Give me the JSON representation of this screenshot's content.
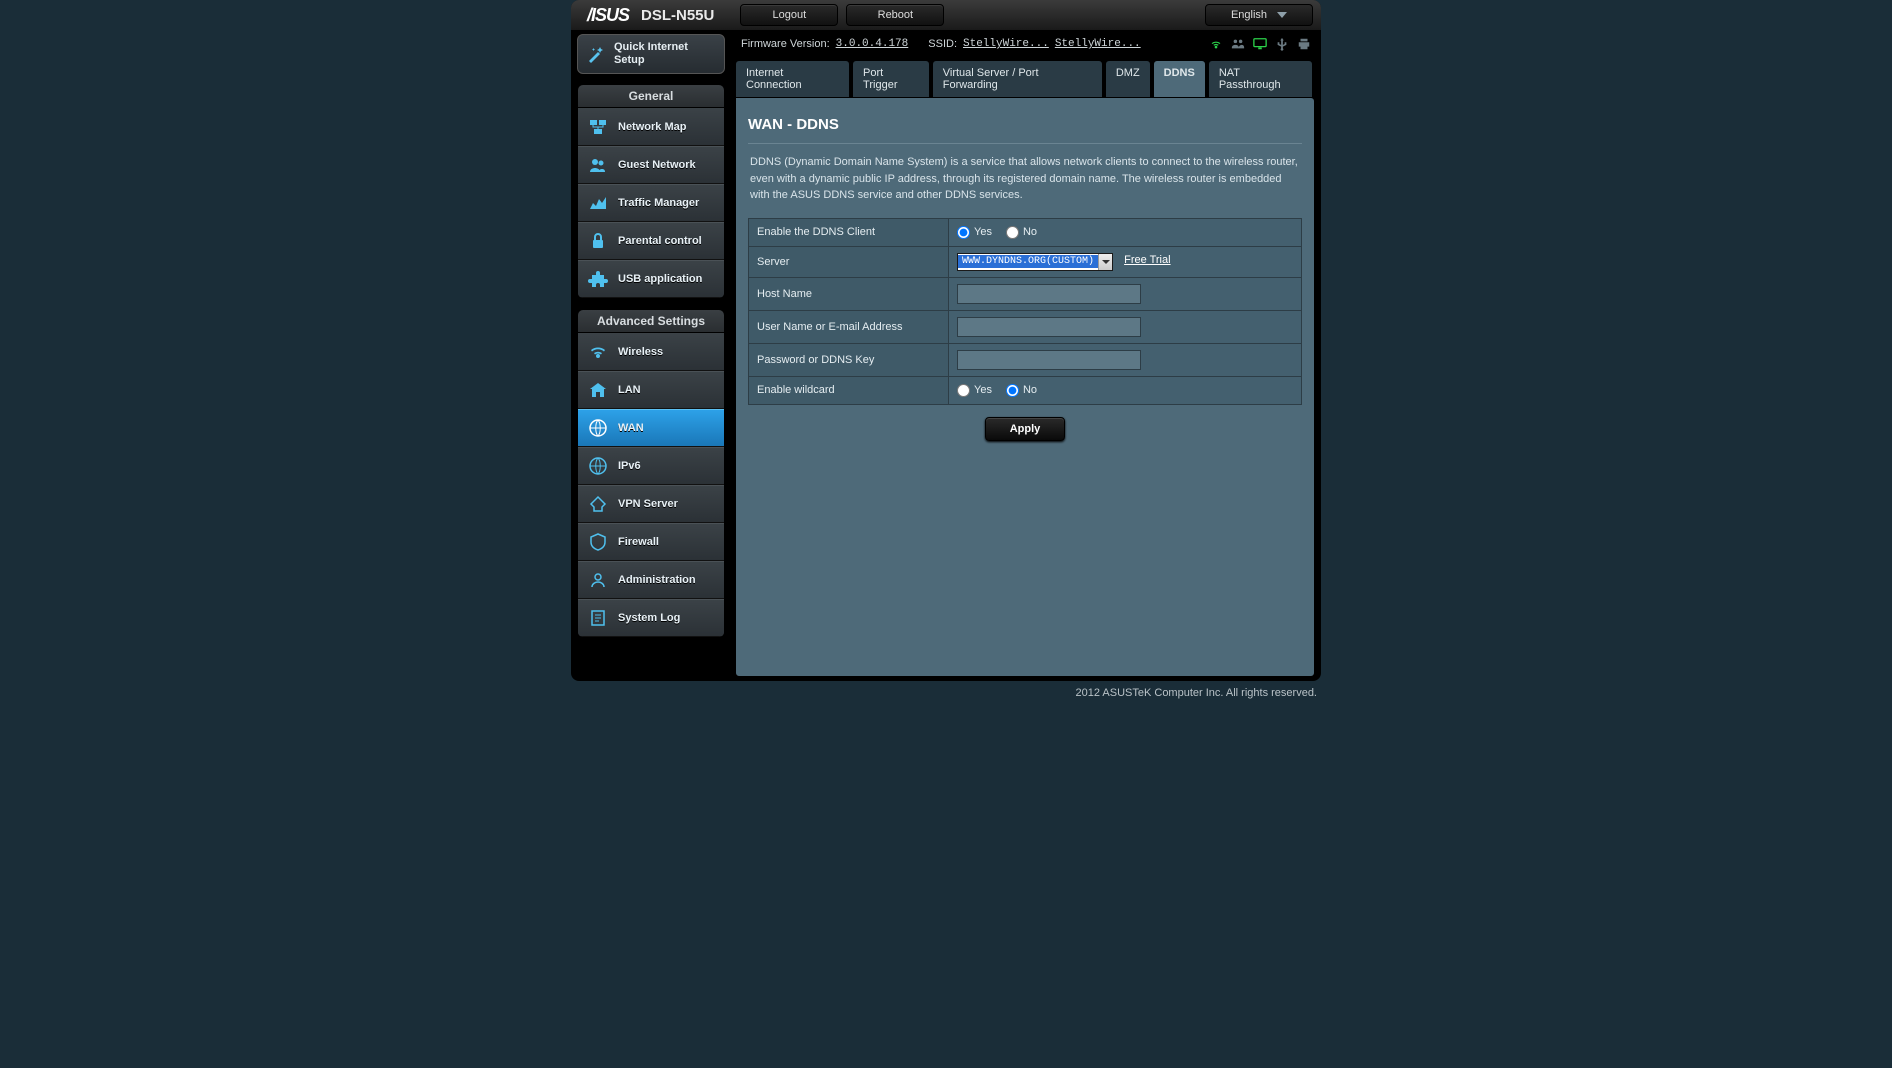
{
  "topbar": {
    "brand": "/ISUS",
    "model": "DSL-N55U",
    "logout": "Logout",
    "reboot": "Reboot",
    "language": "English"
  },
  "info": {
    "fw_label": "Firmware Version:",
    "fw_value": "3.0.0.4.178",
    "ssid_label": "SSID:",
    "ssid1": "StellyWire...",
    "ssid2": "StellyWire..."
  },
  "quick_setup": "Quick Internet Setup",
  "nav_general_title": "General",
  "nav_general": [
    {
      "label": "Network Map"
    },
    {
      "label": "Guest Network"
    },
    {
      "label": "Traffic Manager"
    },
    {
      "label": "Parental control"
    },
    {
      "label": "USB application"
    }
  ],
  "nav_advanced_title": "Advanced Settings",
  "nav_advanced": [
    {
      "label": "Wireless"
    },
    {
      "label": "LAN"
    },
    {
      "label": "WAN"
    },
    {
      "label": "IPv6"
    },
    {
      "label": "VPN Server"
    },
    {
      "label": "Firewall"
    },
    {
      "label": "Administration"
    },
    {
      "label": "System Log"
    }
  ],
  "tabs": [
    "Internet Connection",
    "Port Trigger",
    "Virtual Server / Port Forwarding",
    "DMZ",
    "DDNS",
    "NAT Passthrough"
  ],
  "panel": {
    "title": "WAN - DDNS",
    "description": "DDNS (Dynamic Domain Name System) is a service that allows network clients to connect to the wireless router, even with a dynamic public IP address, through its registered domain name. The wireless router is embedded with the ASUS DDNS service and other DDNS services.",
    "rows": {
      "enable_client": "Enable the DDNS Client",
      "server": "Server",
      "server_value": "WWW.DYNDNS.ORG(CUSTOM)",
      "free_trial": "Free Trial",
      "host_name": "Host Name",
      "user_email": "User Name or E-mail Address",
      "password": "Password or DDNS Key",
      "enable_wildcard": "Enable wildcard"
    },
    "yes": "Yes",
    "no": "No",
    "apply": "Apply"
  },
  "footer": "2012 ASUSTeK Computer Inc. All rights reserved."
}
